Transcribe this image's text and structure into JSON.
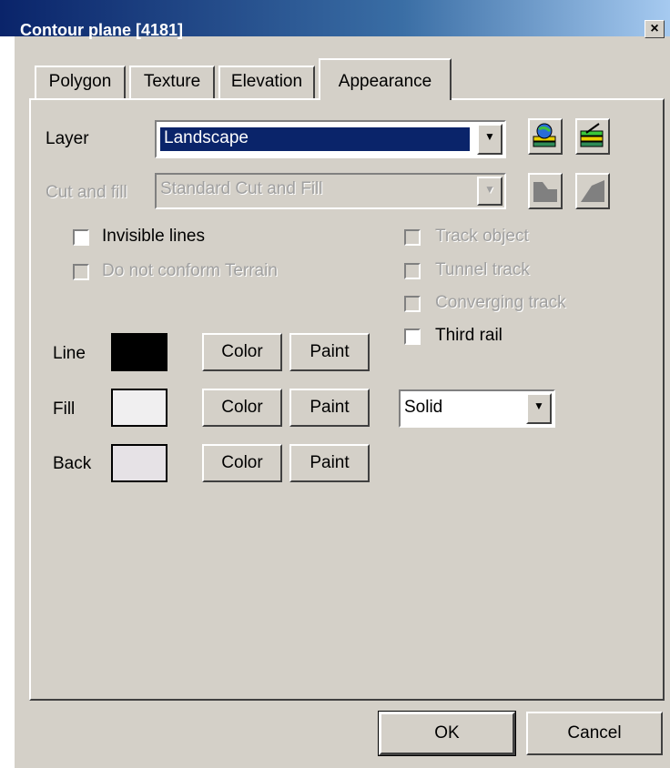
{
  "window": {
    "title": "Contour plane [4181]",
    "close": "×"
  },
  "tabs": [
    {
      "label": "Polygon"
    },
    {
      "label": "Texture"
    },
    {
      "label": "Elevation"
    },
    {
      "label": "Appearance"
    }
  ],
  "layer": {
    "label": "Layer",
    "value": "Landscape",
    "arrow": "▼"
  },
  "cut_fill": {
    "label": "Cut and fill",
    "value": "Standard Cut and Fill",
    "arrow": "▼"
  },
  "checks": {
    "invisible_lines": "Invisible lines",
    "no_conform": "Do not conform Terrain",
    "track_object": "Track object",
    "tunnel_track": "Tunnel track",
    "converging_track": "Converging track",
    "third_rail": "Third rail"
  },
  "rows": {
    "line": "Line",
    "fill": "Fill",
    "back": "Back",
    "color_btn": "Color",
    "paint_btn": "Paint"
  },
  "style": {
    "value": "Solid",
    "arrow": "▼"
  },
  "buttons": {
    "ok": "OK",
    "cancel": "Cancel"
  },
  "colors": {
    "line": "#000000",
    "fill": "#f0eff0",
    "back": "#e6e2e6",
    "titlebar": "#0a246a"
  }
}
